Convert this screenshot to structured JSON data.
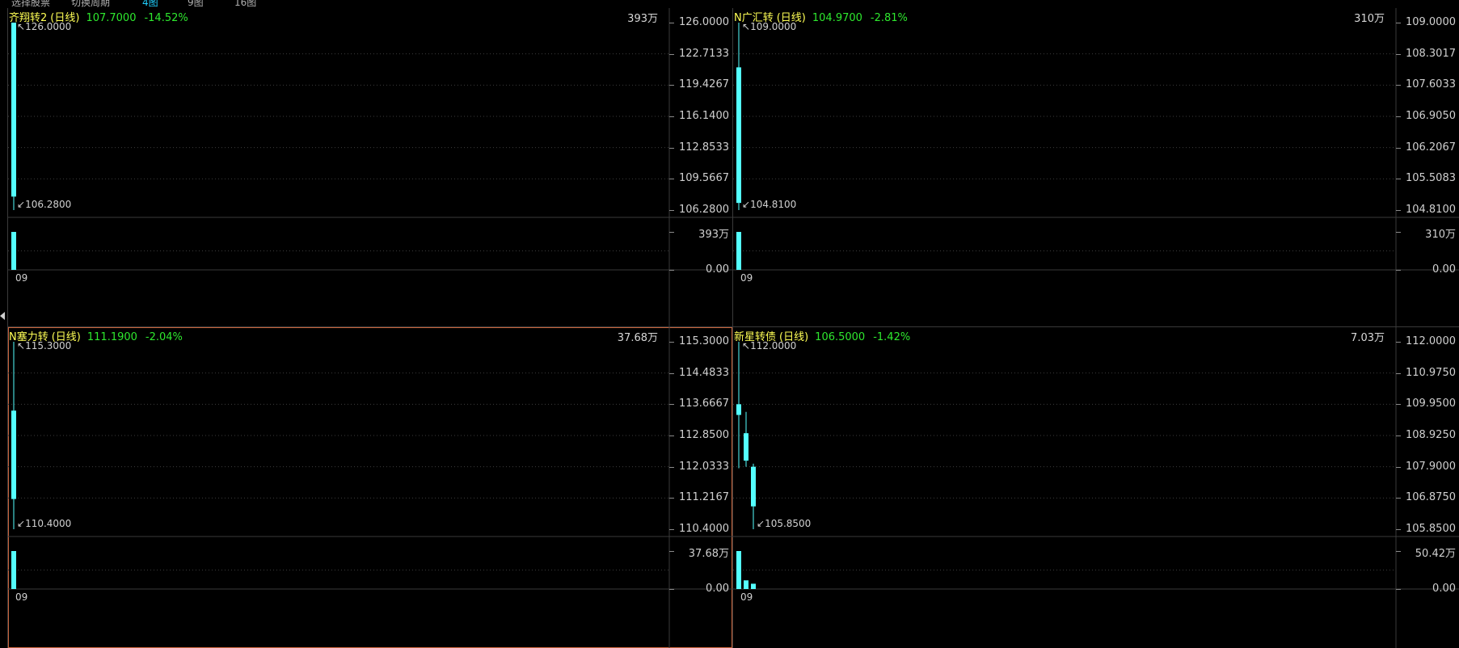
{
  "toolbar": {
    "items": [
      {
        "label": "选择股票",
        "active": false
      },
      {
        "label": "切换周期",
        "active": false
      },
      {
        "label": "4图",
        "active": true
      },
      {
        "label": "9图",
        "active": false
      },
      {
        "label": "16图",
        "active": false
      }
    ]
  },
  "colors": {
    "up": "#54ffff",
    "down": "#54ffff",
    "grid": "#3c3c3c",
    "name": "#ffff55",
    "green": "#2ee82e",
    "selected_border": "#c8643c"
  },
  "panes": [
    {
      "name": "齐翔转2",
      "period": "(日线)",
      "price": "107.7000",
      "change": "-14.52%",
      "volume_label": "393万",
      "selected": false,
      "price_ticks": [
        "126.0000",
        "122.7133",
        "119.4267",
        "116.1400",
        "112.8533",
        "109.5667",
        "106.2800"
      ],
      "price_range": [
        106.28,
        126.0
      ],
      "volume_ticks": [
        "393万",
        "0.00"
      ],
      "volume_max": 393,
      "high_marker": "126.0000",
      "low_marker": "106.2800",
      "date_label": "09",
      "candles": [
        {
          "open": 126.0,
          "close": 107.7,
          "high": 126.0,
          "low": 106.28,
          "volume": 393
        }
      ]
    },
    {
      "name": "N广汇转",
      "period": "(日线)",
      "price": "104.9700",
      "change": "-2.81%",
      "volume_label": "310万",
      "selected": false,
      "price_ticks": [
        "109.0000",
        "108.3017",
        "107.6033",
        "106.9050",
        "106.2067",
        "105.5083",
        "104.8100"
      ],
      "price_range": [
        104.81,
        109.0
      ],
      "volume_ticks": [
        "310万",
        "0.00"
      ],
      "volume_max": 310,
      "high_marker": "109.0000",
      "low_marker": "104.8100",
      "date_label": "09",
      "candles": [
        {
          "open": 108.0,
          "close": 104.97,
          "high": 109.0,
          "low": 104.81,
          "volume": 310
        }
      ]
    },
    {
      "name": "N塞力转",
      "period": "(日线)",
      "price": "111.1900",
      "change": "-2.04%",
      "volume_label": "37.68万",
      "selected": true,
      "price_ticks": [
        "115.3000",
        "114.4833",
        "113.6667",
        "112.8500",
        "112.0333",
        "111.2167",
        "110.4000"
      ],
      "price_range": [
        110.4,
        115.3
      ],
      "volume_ticks": [
        "37.68万",
        "0.00"
      ],
      "volume_max": 37.68,
      "high_marker": "115.3000",
      "low_marker": "110.4000",
      "date_label": "09",
      "candles": [
        {
          "open": 113.5,
          "close": 111.19,
          "high": 115.3,
          "low": 110.4,
          "volume": 37.68
        }
      ]
    },
    {
      "name": "新星转债",
      "period": "(日线)",
      "price": "106.5000",
      "change": "-1.42%",
      "volume_label": "7.03万",
      "selected": false,
      "price_ticks": [
        "112.0000",
        "110.9750",
        "109.9500",
        "108.9250",
        "107.9000",
        "106.8750",
        "105.8500"
      ],
      "price_range": [
        105.85,
        112.0
      ],
      "volume_ticks": [
        "50.42万",
        "0.00"
      ],
      "volume_max": 50.42,
      "high_marker": "112.0000",
      "low_marker": "105.8500",
      "date_label": "09",
      "candles": [
        {
          "open": 109.95,
          "close": 109.6,
          "high": 112.0,
          "low": 107.85,
          "volume": 50.42
        },
        {
          "open": 109.0,
          "close": 108.1,
          "high": 109.7,
          "low": 107.9,
          "volume": 11.5
        },
        {
          "open": 107.9,
          "close": 106.6,
          "high": 108.0,
          "low": 105.85,
          "volume": 7.03
        }
      ]
    }
  ]
}
